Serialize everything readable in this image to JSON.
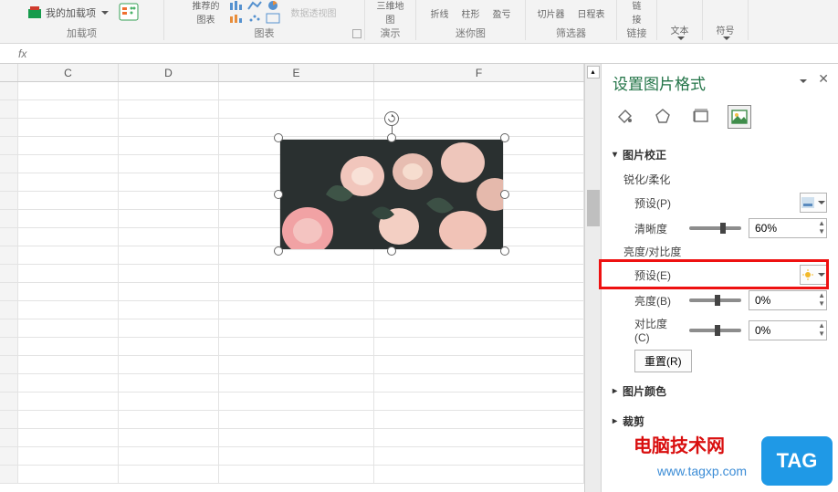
{
  "ribbon": {
    "addins_btn": "我的加载项",
    "groups": {
      "addins": "加载项",
      "charts": "图表",
      "charts_rec1": "推荐的",
      "charts_rec2": "图表",
      "map1": "三维地",
      "map2": "图",
      "demo": "演示",
      "pivot": "数据透视图",
      "spark_line": "折线",
      "spark_col": "柱形",
      "spark_wl": "盈亏",
      "spark": "迷你图",
      "slicer": "切片器",
      "timeline": "日程表",
      "filters": "筛选器",
      "link1": "链",
      "link2": "接",
      "links": "链接",
      "textbox1": "文本",
      "textbox2": "",
      "symbol1": "符号",
      "symbol2": ""
    }
  },
  "formula_bar_fx": "fx",
  "columns": [
    "",
    "C",
    "D",
    "E",
    "F"
  ],
  "pane": {
    "title": "设置图片格式",
    "sections": {
      "correction": "图片校正",
      "sharp_soft": "锐化/柔化",
      "preset_p": "预设(P)",
      "sharpness": "清晰度",
      "sharpness_value": "60%",
      "bright_contrast": "亮度/对比度",
      "preset_e": "预设(E)",
      "brightness": "亮度(B)",
      "brightness_value": "0%",
      "contrast": "对比度(C)",
      "contrast_value": "0%",
      "reset": "重置(R)",
      "color": "图片颜色",
      "crop": "裁剪"
    }
  },
  "watermark": {
    "text1": "电脑技术网",
    "text2": "www.tagxp.com",
    "tag": "TAG"
  }
}
